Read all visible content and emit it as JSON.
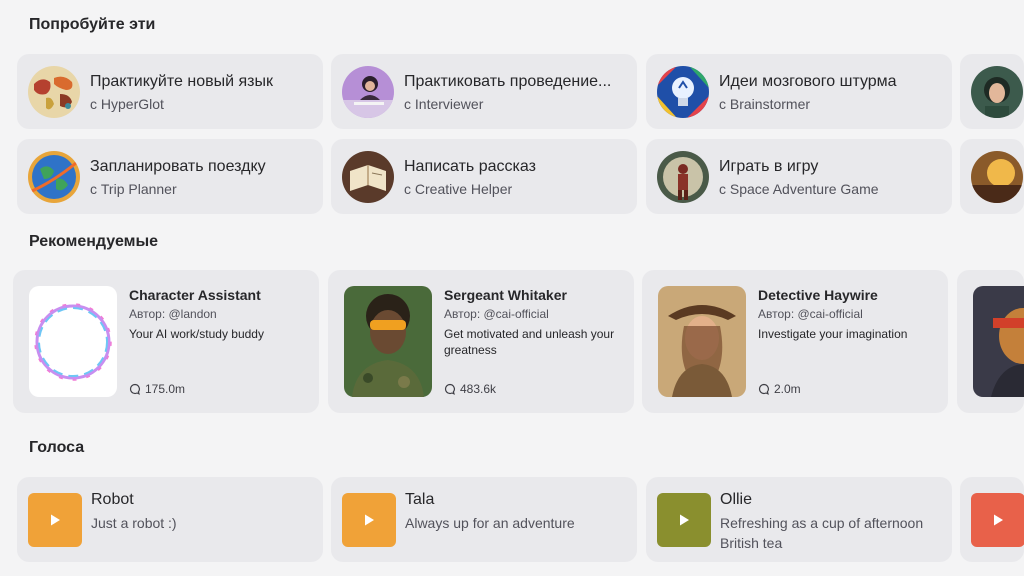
{
  "sections": {
    "suggestions_title": "Попробуйте эти",
    "featured_title": "Рекомендуемые",
    "voices_title": "Голоса"
  },
  "suggestions": [
    {
      "title": "Практикуйте новый язык",
      "subtitle": "с HyperGlot",
      "icon": "world-map-avatar"
    },
    {
      "title": "Практиковать проведение...",
      "subtitle": "с Interviewer",
      "icon": "interviewer-avatar"
    },
    {
      "title": "Идеи мозгового штурма",
      "subtitle": "с Brainstormer",
      "icon": "lightbulb-avatar"
    },
    {
      "title": "Запланировать поездку",
      "subtitle": "с Trip Planner",
      "icon": "globe-avatar"
    },
    {
      "title": "Написать рассказ",
      "subtitle": "с Creative Helper",
      "icon": "notebook-avatar"
    },
    {
      "title": "Играть в игру",
      "subtitle": "с Space Adventure Game",
      "icon": "astronaut-avatar"
    }
  ],
  "featured": [
    {
      "name": "Character Assistant",
      "author": "Автор: @landon",
      "desc": "Your AI work/study buddy",
      "chats": "175.0m"
    },
    {
      "name": "Sergeant Whitaker",
      "author": "Автор: @cai-official",
      "desc": "Get motivated and unleash your greatness",
      "chats": "483.6k"
    },
    {
      "name": "Detective Haywire",
      "author": "Автор: @cai-official",
      "desc": "Investigate your imagination",
      "chats": "2.0m"
    }
  ],
  "voices": [
    {
      "name": "Robot",
      "desc": "Just a robot :)",
      "color": "#f0a238"
    },
    {
      "name": "Tala",
      "desc": "Always up for an adventure",
      "color": "#f0a238"
    },
    {
      "name": "Ollie",
      "desc": "Refreshing as a cup of afternoon British tea",
      "color": "#8a8f2e"
    }
  ],
  "colors": {
    "background": "#f4f4f5",
    "card": "#e9e9ec",
    "voice_partial": "#e8614a"
  }
}
